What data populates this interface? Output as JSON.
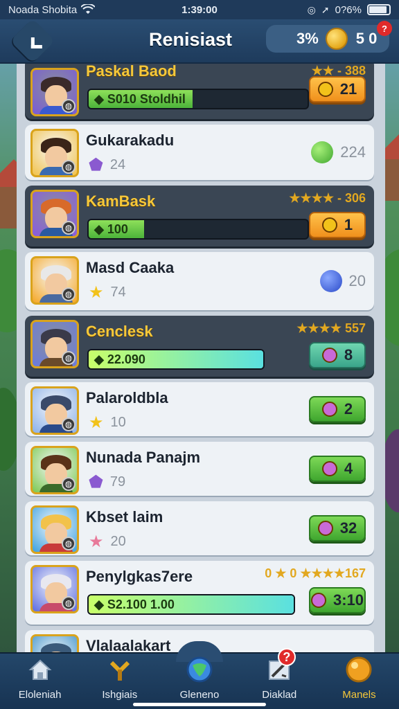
{
  "status_bar": {
    "carrier": "Noada Shobita",
    "time": "1:39:00",
    "battery_pct": "0?6%",
    "battery_level": 0.9
  },
  "header": {
    "title": "Renisiast",
    "currency_pct": "3%",
    "currency_amount": "5 0",
    "notif_count": "?",
    "back_icon": "chevron-left-icon"
  },
  "rows": [
    {
      "name": "Paskal Baod",
      "style": "dark",
      "stars": "★★ - 388",
      "bar_text": "S010 Stoldhil",
      "bar_fill": 1.0,
      "bar_color": "green",
      "button": "21",
      "button_color": "orange"
    },
    {
      "name": "Gukarakadu",
      "style": "light",
      "sub_value": "24",
      "sub_gem": "purple",
      "side_value": "224",
      "side_orb": "green"
    },
    {
      "name": "KamBask",
      "style": "dark",
      "stars": "★★★★ - 306",
      "bar_text": "100",
      "bar_fill": 0.25,
      "bar_color": "green",
      "button": "1",
      "button_color": "orange"
    },
    {
      "name": "Masd Caaka",
      "style": "light",
      "sub_value": "74",
      "sub_gem": "yellow",
      "side_value": "20",
      "side_orb": "blue"
    },
    {
      "name": "Cenclesk",
      "style": "dark",
      "stars": "★★★★ 557",
      "bar_text": "22.090",
      "bar_fill": 1.0,
      "bar_color": "cyan",
      "button": "8",
      "button_color": "teal"
    },
    {
      "name": "Palaroldbla",
      "style": "light",
      "sub_value": "10",
      "sub_gem": "yellow",
      "button": "2",
      "button_color": "green"
    },
    {
      "name": "Nunada Panajm",
      "style": "light",
      "sub_value": "79",
      "sub_gem": "purple",
      "button": "4",
      "button_color": "green"
    },
    {
      "name": "Kbset laim",
      "style": "light",
      "sub_value": "20",
      "sub_gem": "pink",
      "button": "32",
      "button_color": "green"
    },
    {
      "name": "Penylgkas7ere",
      "style": "light",
      "stars": "0 ★ 0 ★★★★167",
      "bar_text": "S2.100 1.00",
      "bar_fill": 1.0,
      "bar_color": "cyan",
      "button": "3:10",
      "button_color": "green"
    },
    {
      "name": "Vlalaalakart",
      "style": "light"
    }
  ],
  "bottom_nav": [
    {
      "label": "Eloleniah",
      "icon": "home-icon"
    },
    {
      "label": "Ishgiais",
      "icon": "hammer-icon"
    },
    {
      "label": "Gleneno",
      "icon": "globe-icon"
    },
    {
      "label": "Diaklad",
      "icon": "sword-icon",
      "badge": "?"
    },
    {
      "label": "Manels",
      "icon": "orb-icon",
      "active": true
    }
  ]
}
